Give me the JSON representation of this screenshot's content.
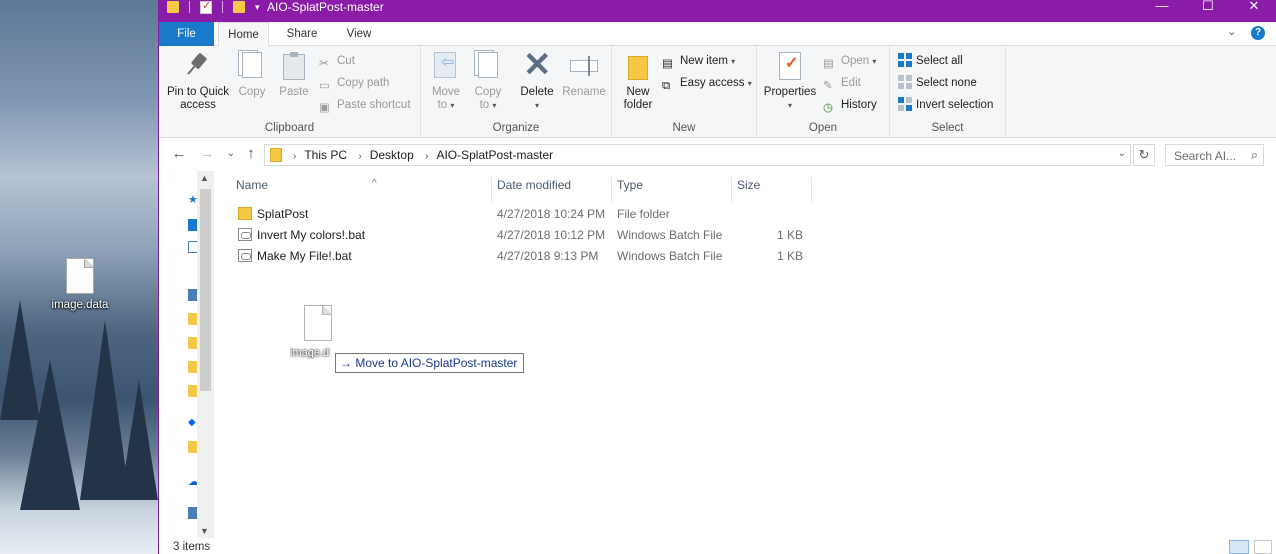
{
  "desktop": {
    "icon_label": "image.data"
  },
  "window": {
    "title": "AIO-SplatPost-master",
    "controls": {
      "minimize": "—",
      "maximize": "☐",
      "close": "✕"
    }
  },
  "tabs": {
    "file": "File",
    "home": "Home",
    "share": "Share",
    "view": "View"
  },
  "ribbon": {
    "clipboard": {
      "label": "Clipboard",
      "pin_line1": "Pin to Quick",
      "pin_line2": "access",
      "copy": "Copy",
      "paste": "Paste",
      "cut": "Cut",
      "copy_path": "Copy path",
      "paste_shortcut": "Paste shortcut"
    },
    "organize": {
      "label": "Organize",
      "move_to_line1": "Move",
      "move_to_line2": "to",
      "copy_to_line1": "Copy",
      "copy_to_line2": "to",
      "delete": "Delete",
      "rename": "Rename"
    },
    "new": {
      "label": "New",
      "new_folder_line1": "New",
      "new_folder_line2": "folder",
      "new_item": "New item",
      "easy_access": "Easy access"
    },
    "open": {
      "label": "Open",
      "properties": "Properties",
      "open": "Open",
      "edit": "Edit",
      "history": "History"
    },
    "select": {
      "label": "Select",
      "select_all": "Select all",
      "select_none": "Select none",
      "invert_selection": "Invert selection"
    }
  },
  "address": {
    "crumbs": [
      "This PC",
      "Desktop",
      "AIO-SplatPost-master"
    ],
    "search_placeholder": "Search AI..."
  },
  "columns": {
    "name": "Name",
    "date_modified": "Date modified",
    "type": "Type",
    "size": "Size"
  },
  "files": [
    {
      "name": "SplatPost",
      "date": "4/27/2018 10:24 PM",
      "type": "File folder",
      "size": "",
      "icon": "folder-icon"
    },
    {
      "name": "Invert My colors!.bat",
      "date": "4/27/2018 10:12 PM",
      "type": "Windows Batch File",
      "size": "1 KB",
      "icon": "batch-file-icon"
    },
    {
      "name": "Make My File!.bat",
      "date": "4/27/2018 9:13 PM",
      "type": "Windows Batch File",
      "size": "1 KB",
      "icon": "batch-file-icon"
    }
  ],
  "drag": {
    "ghost_label": "image.d",
    "tooltip": "Move to AIO-SplatPost-master"
  },
  "status": {
    "item_count": "3 items"
  },
  "colors": {
    "titlebar": "#8a1ca8",
    "file_tab": "#1979ca",
    "folder": "#f3c947"
  }
}
